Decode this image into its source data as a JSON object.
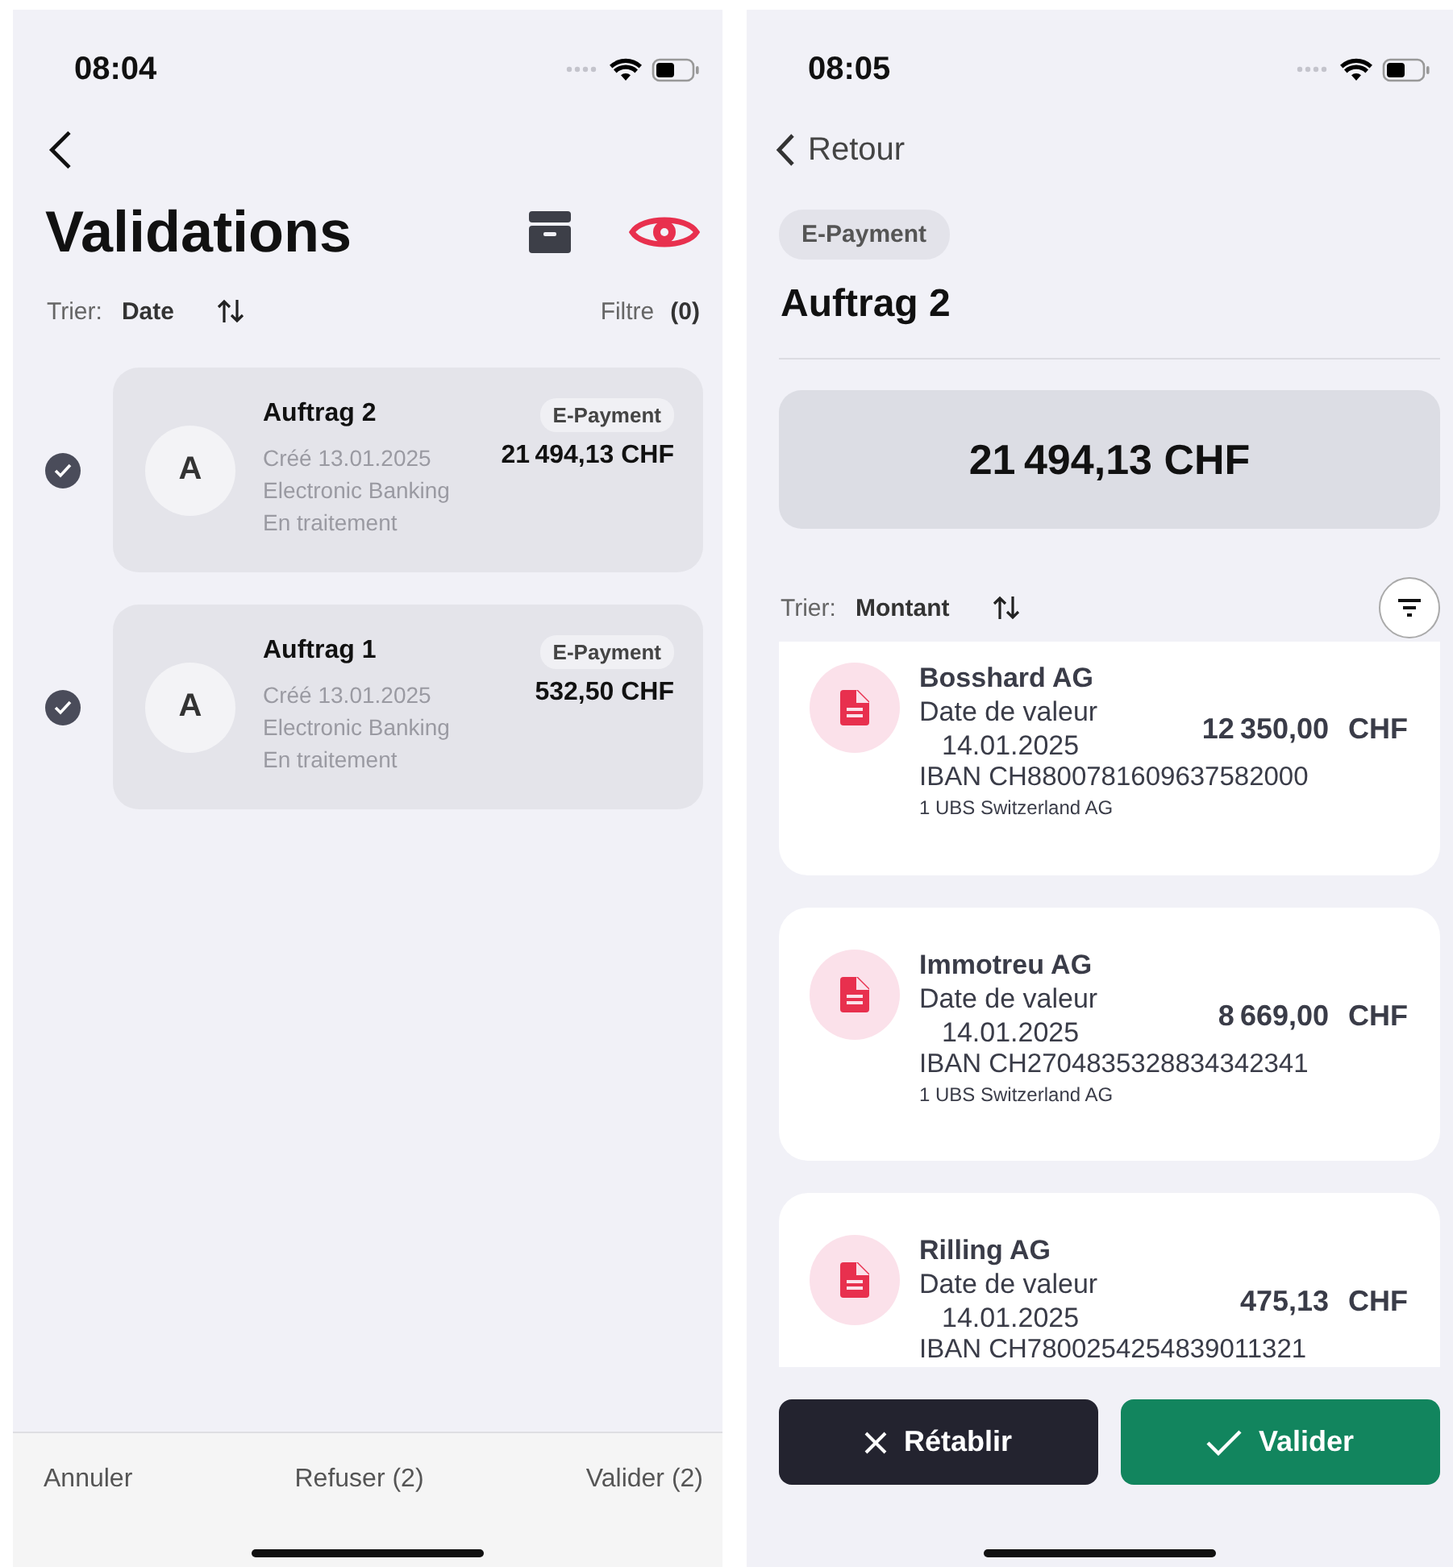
{
  "left_screen": {
    "status_time": "08:04",
    "title": "Validations",
    "sort": {
      "label": "Trier:",
      "value": "Date"
    },
    "filter": {
      "label": "Filtre",
      "count": "(0)"
    },
    "orders": [
      {
        "title": "Auftrag 2",
        "avatar": "A",
        "created": "Créé 13.01.2025",
        "channel": "Electronic Banking",
        "status": "En traitement",
        "badge": "E-Payment",
        "amount": "21 494,13 CHF",
        "checked": true
      },
      {
        "title": "Auftrag 1",
        "avatar": "A",
        "created": "Créé 13.01.2025",
        "channel": "Electronic Banking",
        "status": "En traitement",
        "badge": "E-Payment",
        "amount": "532,50 CHF",
        "checked": true
      }
    ],
    "actions": [
      "Annuler",
      "Refuser (2)",
      "Valider (2)"
    ]
  },
  "right_screen": {
    "status_time": "08:05",
    "back": "Retour",
    "chip": "E-Payment",
    "title": "Auftrag 2",
    "total": "21 494,13 CHF",
    "sort": {
      "label": "Trier:",
      "value": "Montant"
    },
    "payments": [
      {
        "name": "Bosshard AG",
        "date_label": "Date de valeur",
        "date": "14.01.2025",
        "amount": "12 350,00",
        "currency": "CHF",
        "iban": "IBAN CH8800781609637582000",
        "bank": "1 UBS Switzerland AG"
      },
      {
        "name": "Immotreu AG",
        "date_label": "Date de valeur",
        "date": "14.01.2025",
        "amount": "8 669,00",
        "currency": "CHF",
        "iban": "IBAN CH2704835328834342341",
        "bank": "1 UBS Switzerland AG"
      },
      {
        "name": "Rilling AG",
        "date_label": "Date de valeur",
        "date": "14.01.2025",
        "amount": "475,13",
        "currency": "CHF",
        "iban": "IBAN CH7800254254839011321"
      }
    ],
    "buttons": [
      {
        "label": "Rétablir",
        "kind": "reset"
      },
      {
        "label": "Valider",
        "kind": "confirm"
      }
    ]
  }
}
